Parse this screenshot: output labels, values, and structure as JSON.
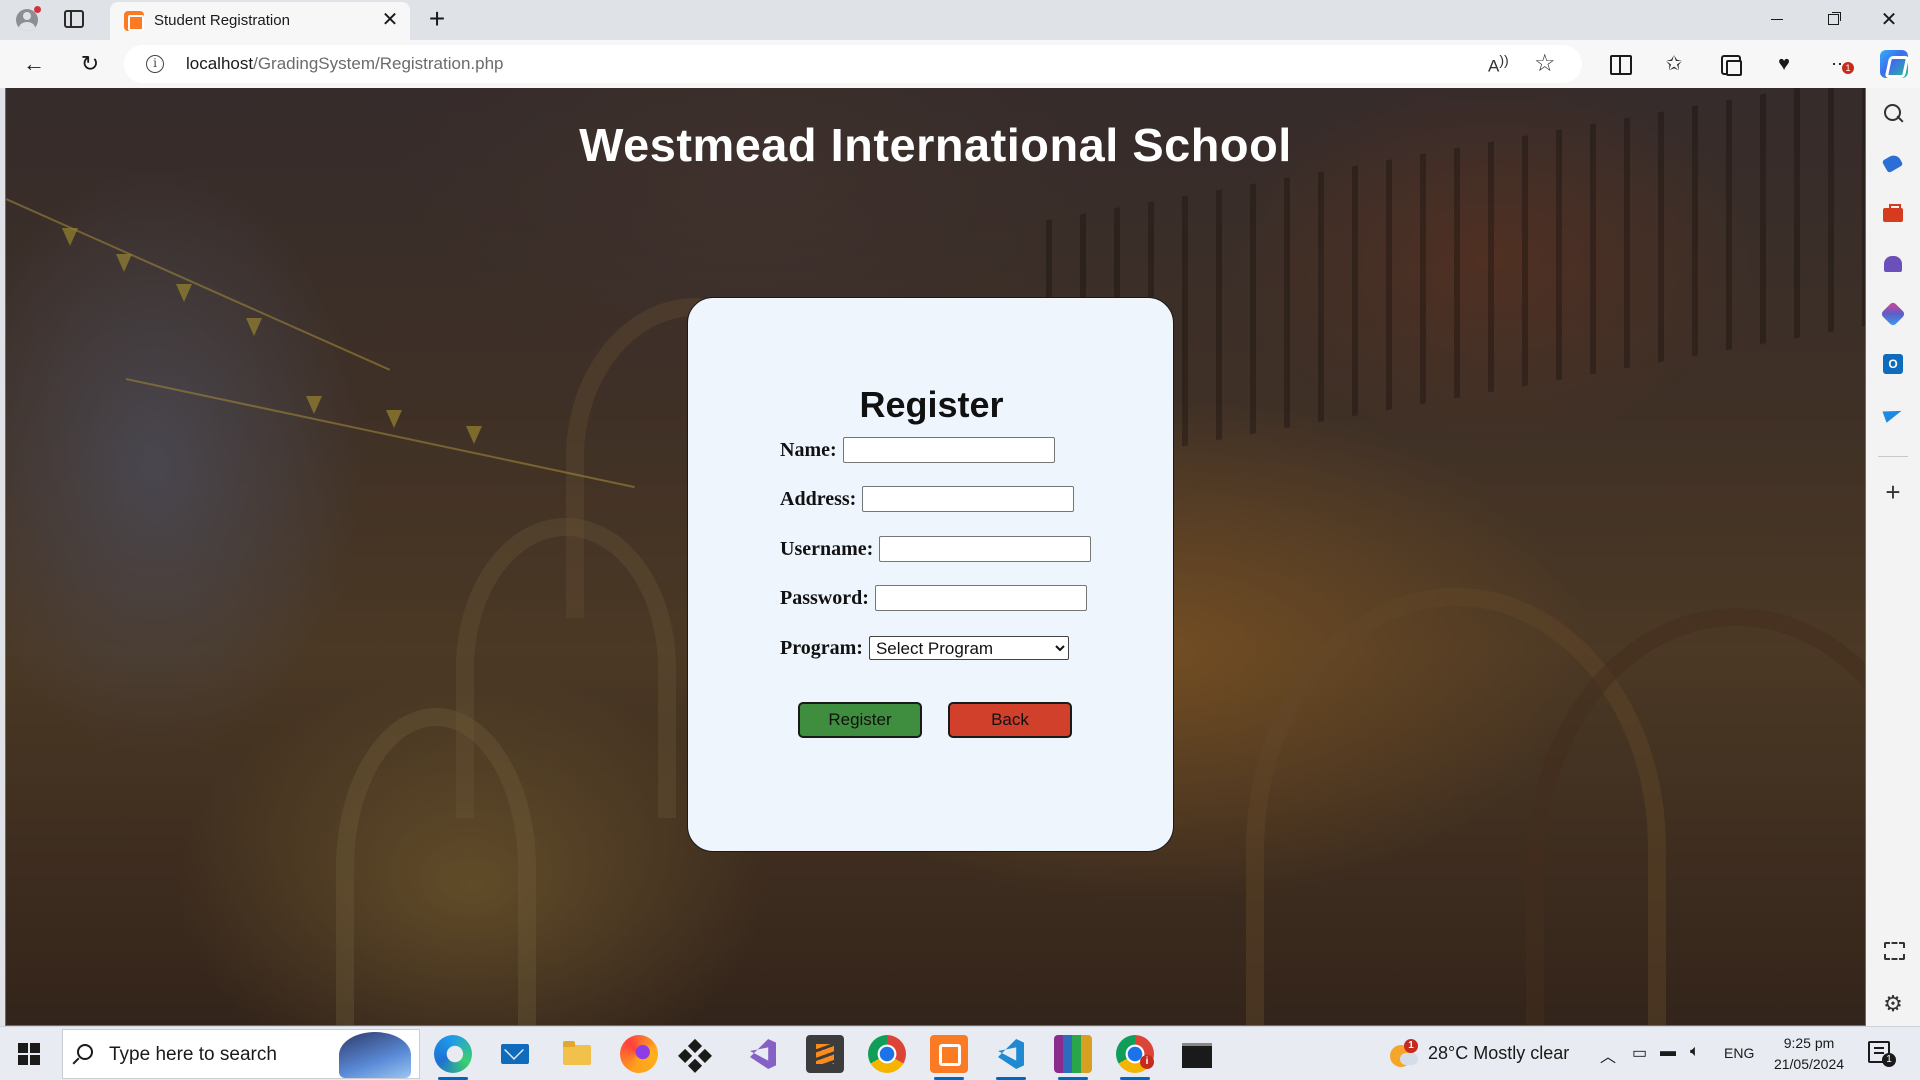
{
  "browser": {
    "tab_title": "Student Registration",
    "tab_close": "✕",
    "new_tab": "+",
    "url_host": "localhost",
    "url_path": "/GradingSystem/Registration.php",
    "more_badge": "1",
    "window": {
      "minimize": "",
      "maximize": "",
      "close": "✕"
    }
  },
  "page": {
    "school_name": "Westmead International School",
    "form": {
      "title": "Register",
      "name_label": "Name:",
      "name_value": "",
      "address_label": "Address:",
      "address_value": "",
      "username_label": "Username:",
      "username_value": "",
      "password_label": "Password:",
      "password_value": "",
      "program_label": "Program:",
      "program_selected": "Select Program",
      "register_button": "Register",
      "back_button": "Back"
    },
    "colors": {
      "card_bg": "#eef5fd",
      "register_btn": "#3f8e3f",
      "back_btn": "#d0402b"
    }
  },
  "taskbar": {
    "search_placeholder": "Type here to search",
    "weather_badge": "1",
    "weather": "28°C  Mostly clear",
    "language": "ENG",
    "time": "9:25 pm",
    "date": "21/05/2024",
    "notification_count": "1",
    "apps": [
      "edge-icon",
      "mail-icon",
      "file-explorer-icon",
      "firefox-icon",
      "dropbox-icon",
      "visual-studio-icon",
      "sublime-text-icon",
      "chrome-icon",
      "xampp-icon",
      "vscode-icon",
      "winrar-icon",
      "chrome-profile-icon",
      "terminal-icon"
    ]
  },
  "sidebar_icons": [
    "search-icon",
    "shopping-icon",
    "tools-icon",
    "games-icon",
    "office-icon",
    "outlook-icon",
    "send-icon",
    "add-icon",
    "screenshot-icon",
    "settings-icon"
  ]
}
